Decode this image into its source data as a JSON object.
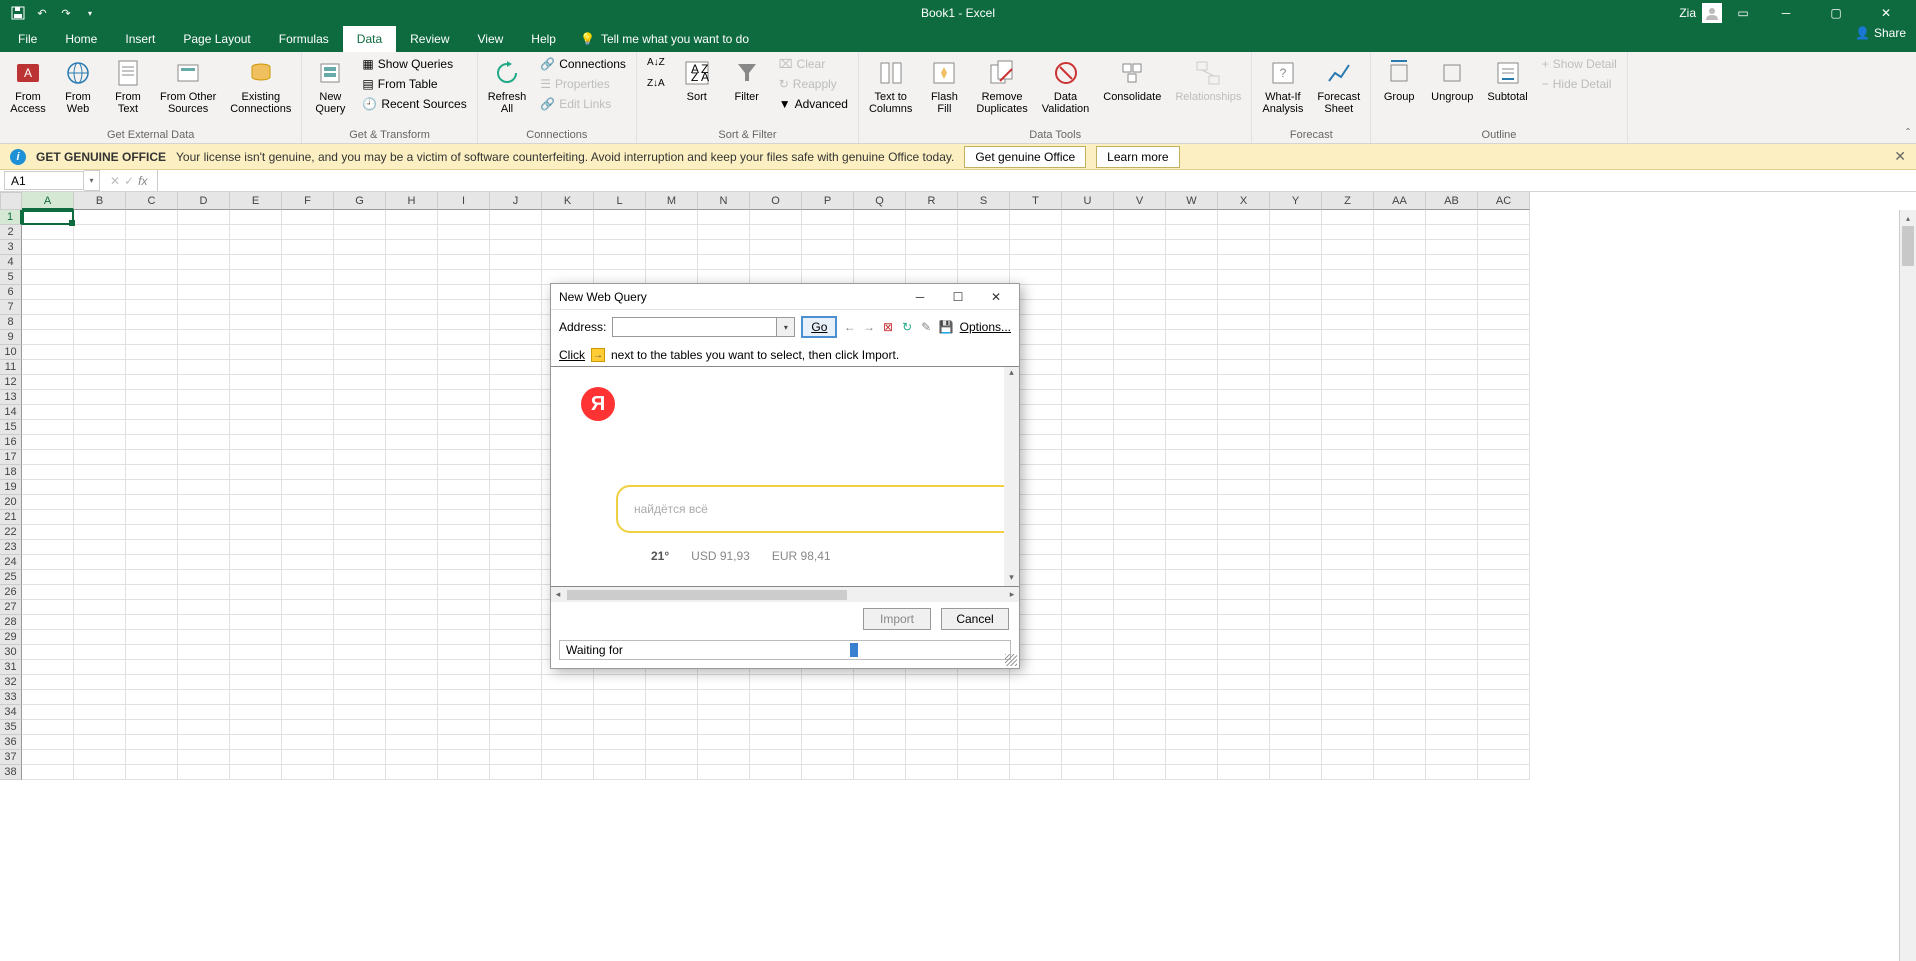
{
  "titlebar": {
    "title": "Book1 - Excel",
    "user": "Zia"
  },
  "tabs": {
    "file": "File",
    "home": "Home",
    "insert": "Insert",
    "pagelayout": "Page Layout",
    "formulas": "Formulas",
    "data": "Data",
    "review": "Review",
    "view": "View",
    "help": "Help",
    "tellme": "Tell me what you want to do",
    "share": "Share"
  },
  "ribbon": {
    "get_external": {
      "from_access": "From\nAccess",
      "from_web": "From\nWeb",
      "from_text": "From\nText",
      "from_other": "From Other\nSources",
      "existing": "Existing\nConnections",
      "label": "Get External Data"
    },
    "get_transform": {
      "new_query": "New\nQuery",
      "show_queries": "Show Queries",
      "from_table": "From Table",
      "recent": "Recent Sources",
      "label": "Get & Transform"
    },
    "connections": {
      "refresh": "Refresh\nAll",
      "connections": "Connections",
      "properties": "Properties",
      "edit_links": "Edit Links",
      "label": "Connections"
    },
    "sort_filter": {
      "sort": "Sort",
      "filter": "Filter",
      "clear": "Clear",
      "reapply": "Reapply",
      "advanced": "Advanced",
      "label": "Sort & Filter"
    },
    "data_tools": {
      "text_cols": "Text to\nColumns",
      "flash": "Flash\nFill",
      "remove_dup": "Remove\nDuplicates",
      "validation": "Data\nValidation",
      "consolidate": "Consolidate",
      "relationships": "Relationships",
      "label": "Data Tools"
    },
    "forecast": {
      "whatif": "What-If\nAnalysis",
      "sheet": "Forecast\nSheet",
      "label": "Forecast"
    },
    "outline": {
      "group": "Group",
      "ungroup": "Ungroup",
      "subtotal": "Subtotal",
      "show_detail": "Show Detail",
      "hide_detail": "Hide Detail",
      "label": "Outline"
    }
  },
  "warning": {
    "title": "GET GENUINE OFFICE",
    "text": "Your license isn't genuine, and you may be a victim of software counterfeiting. Avoid interruption and keep your files safe with genuine Office today.",
    "btn1": "Get genuine Office",
    "btn2": "Learn more"
  },
  "formula": {
    "namebox": "A1"
  },
  "columns": [
    "A",
    "B",
    "C",
    "D",
    "E",
    "F",
    "G",
    "H",
    "I",
    "J",
    "K",
    "L",
    "M",
    "N",
    "O",
    "P",
    "Q",
    "R",
    "S",
    "T",
    "U",
    "V",
    "W",
    "X",
    "Y",
    "Z",
    "AA",
    "AB",
    "AC"
  ],
  "dialog": {
    "title": "New Web Query",
    "address_label": "Address:",
    "go": "Go",
    "options": "Options...",
    "hint_click": "Click",
    "hint_text": "next to the tables you want to select, then click Import.",
    "search_placeholder": "найдётся всё",
    "temp": "21°",
    "usd": "USD 91,93",
    "eur": "EUR 98,41",
    "import": "Import",
    "cancel": "Cancel",
    "status": "Waiting for"
  }
}
